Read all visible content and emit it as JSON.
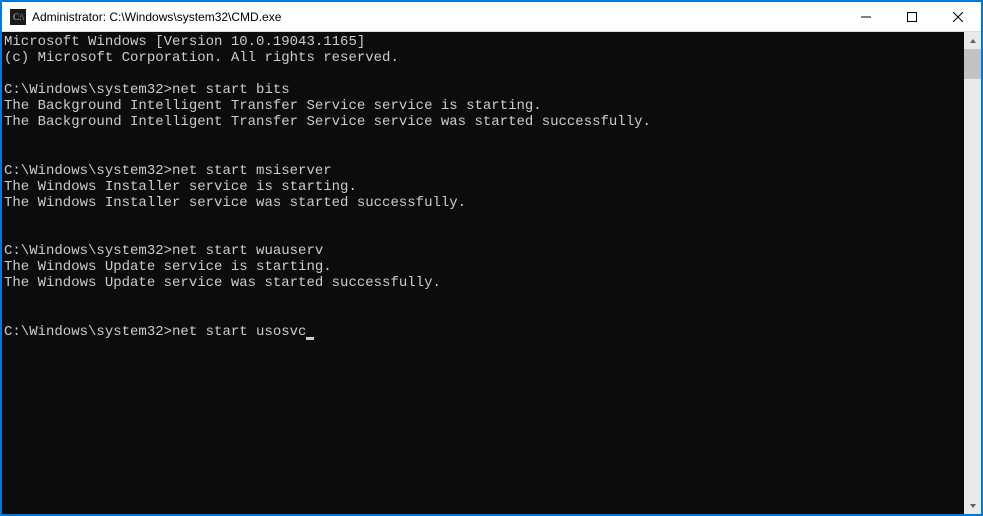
{
  "titlebar": {
    "title": "Administrator: C:\\Windows\\system32\\CMD.exe"
  },
  "terminal": {
    "header_line1": "Microsoft Windows [Version 10.0.19043.1165]",
    "header_line2": "(c) Microsoft Corporation. All rights reserved.",
    "blocks": [
      {
        "prompt": "C:\\Windows\\system32>",
        "command": "net start bits",
        "out1": "The Background Intelligent Transfer Service service is starting.",
        "out2": "The Background Intelligent Transfer Service service was started successfully."
      },
      {
        "prompt": "C:\\Windows\\system32>",
        "command": "net start msiserver",
        "out1": "The Windows Installer service is starting.",
        "out2": "The Windows Installer service was started successfully."
      },
      {
        "prompt": "C:\\Windows\\system32>",
        "command": "net start wuauserv",
        "out1": "The Windows Update service is starting.",
        "out2": "The Windows Update service was started successfully."
      }
    ],
    "current": {
      "prompt": "C:\\Windows\\system32>",
      "command": "net start usosvc"
    }
  }
}
